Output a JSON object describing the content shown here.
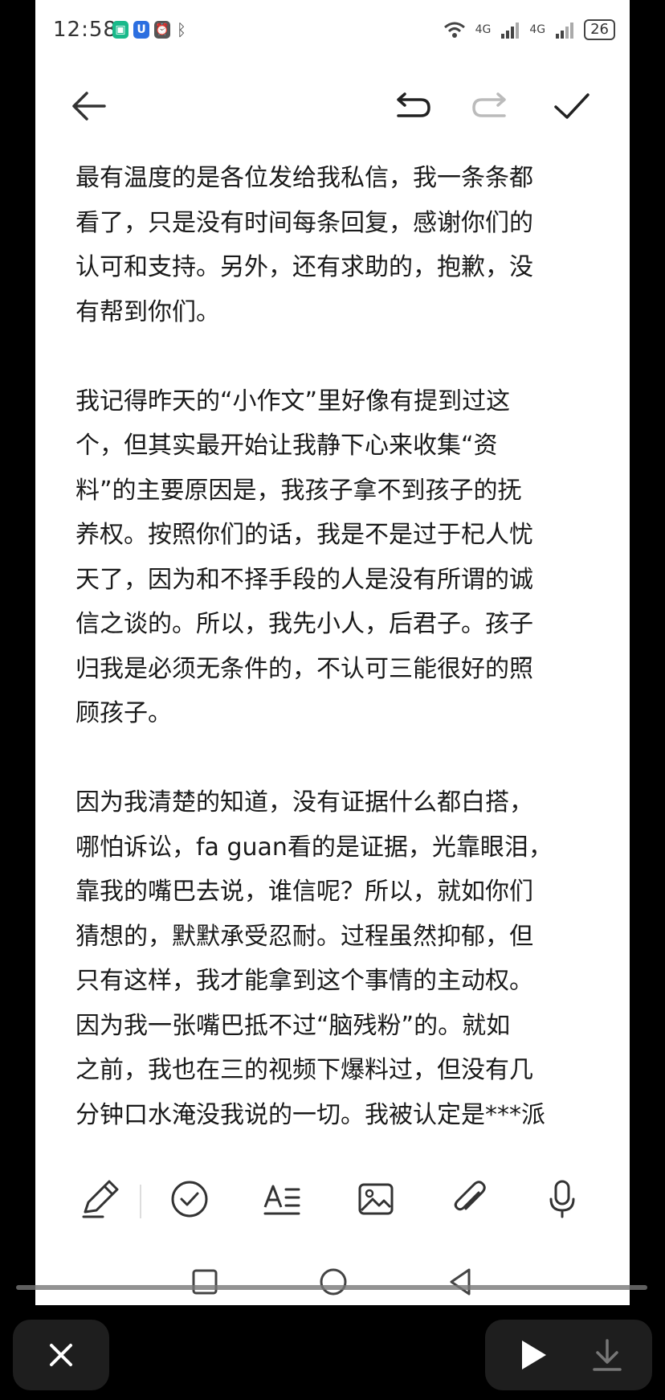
{
  "status_bar": {
    "time": "12:58",
    "network_1": "4G",
    "network_2": "4G",
    "battery": "26"
  },
  "toolbar_top": {
    "back_icon": "arrow-left-icon",
    "undo_icon": "undo-icon",
    "redo_icon": "redo-icon",
    "confirm_icon": "checkmark-icon"
  },
  "note": {
    "paragraphs": [
      "最有温度的是各位发给我私信，我一条条都\n看了，只是没有时间每条回复，感谢你们的\n认可和支持。另外，还有求助的，抱歉，没\n有帮到你们。",
      "我记得昨天的“小作文”里好像有提到过这\n个，但其实最开始让我静下心来收集“资\n料”的主要原因是，我孩子拿不到孩子的抚\n养权。按照你们的话，我是不是过于杞人忧\n天了，因为和不择手段的人是没有所谓的诚\n信之谈的。所以，我先小人，后君子。孩子\n归我是必须无条件的，不认可三能很好的照\n顾孩子。",
      "因为我清楚的知道，没有证据什么都白搭，\n哪怕诉讼，fa guan看的是证据，光靠眼泪，\n靠我的嘴巴去说，谁信呢？所以，就如你们\n猜想的，默默承受忍耐。过程虽然抑郁，但\n只有这样，我才能拿到这个事情的主动权。\n因为我一张嘴巴抵不过“脑残粉”的。就如\n之前，我也在三的视频下爆料过，但没有几\n分钟口水淹没我说的一切。我被认定是***派"
    ]
  },
  "editor_toolbar": {
    "icons": [
      "pen-icon",
      "checklist-icon",
      "text-format-icon",
      "image-icon",
      "attachment-icon",
      "microphone-icon"
    ]
  },
  "nav_bar": {
    "icons": [
      "recent-apps-icon",
      "home-icon",
      "back-triangle-icon"
    ]
  },
  "player": {
    "close_icon": "close-icon",
    "play_icon": "play-icon",
    "download_icon": "download-icon"
  }
}
